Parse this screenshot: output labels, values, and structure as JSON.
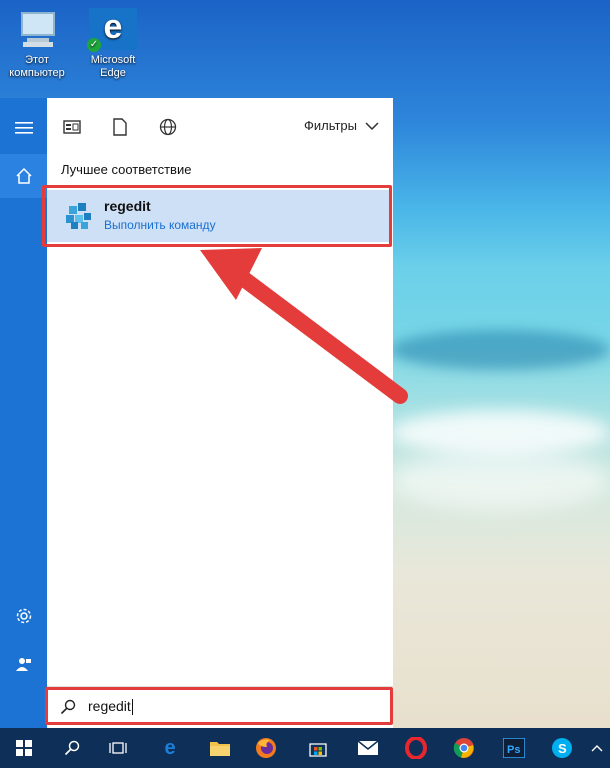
{
  "desktop": {
    "icons": [
      {
        "label": "Этот\nкомпьютер",
        "icon": "this-pc-icon"
      },
      {
        "label": "Microsoft\nEdge",
        "icon": "edge-icon"
      }
    ]
  },
  "start_menu": {
    "rail": {
      "menu_icon": "hamburger-icon",
      "home_icon": "home-icon",
      "settings_icon": "gear-icon",
      "user_icon": "user-icon"
    },
    "toolbar": {
      "apps_icon": "apps-icon",
      "documents_icon": "document-icon",
      "web_icon": "globe-icon",
      "filters_label": "Фильтры"
    },
    "best_match_label": "Лучшее соответствие",
    "result": {
      "title": "regedit",
      "subtitle": "Выполнить команду",
      "icon": "registry-editor-icon"
    },
    "search": {
      "value": "regedit",
      "icon": "search-icon"
    }
  },
  "taskbar": {
    "items": [
      "windows-start-icon",
      "search-icon",
      "task-view-icon",
      "edge-icon",
      "file-explorer-icon",
      "firefox-icon",
      "store-icon",
      "mail-icon",
      "opera-icon",
      "chrome-icon",
      "photoshop-icon",
      "skype-icon",
      "chevron-up-icon"
    ]
  },
  "colors": {
    "accent": "#1c73d3",
    "highlight": "#cde0f6",
    "annotation_red": "#e43b3b",
    "taskbar": "#0e2f57"
  }
}
